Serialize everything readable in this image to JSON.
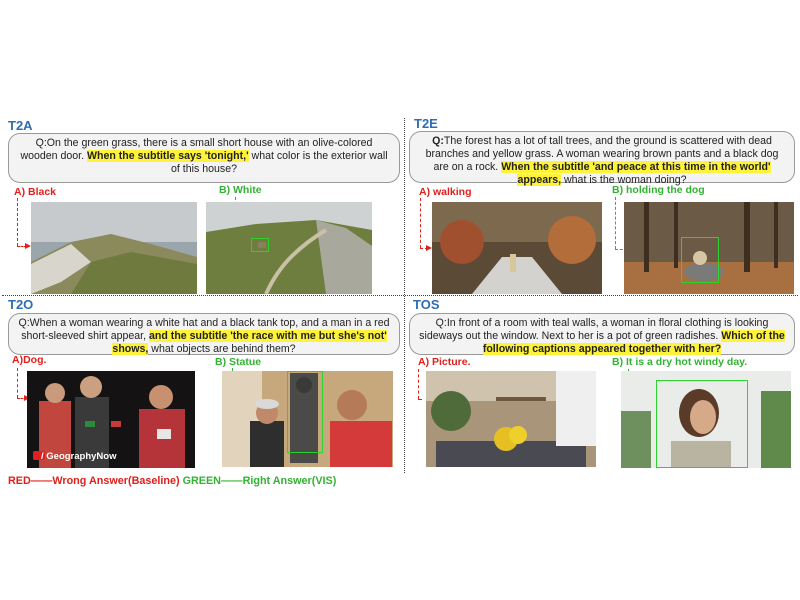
{
  "panels": {
    "t2a": {
      "tag": "T2A",
      "q_pre": "Q:On the green grass, there is a small short house with an olive-colored wooden door. ",
      "q_hl": "When the subtitle says 'tonight,'",
      "q_post": " what color is the exterior wall of this house?",
      "option_a": "A) Black",
      "option_b": "B) White"
    },
    "t2e": {
      "tag": "T2E",
      "q_prefix": "Q:",
      "q_pre": "The forest has a lot of tall trees, and the ground is scattered with dead branches and yellow grass. A woman wearing brown pants and a black dog are on a rock. ",
      "q_hl": "When the subtitle 'and peace at this time in the world' appears,",
      "q_post": " what is the woman doing?",
      "option_a": "A) walking",
      "option_b": "B) holding the dog"
    },
    "t2o": {
      "tag": "T2O",
      "q_pre": "Q:When a woman wearing a white hat and a black tank top, and a man in a red short-sleeved shirt appear, ",
      "q_hl": "and the subtitle 'the race with me but she's not' shows,",
      "q_post": " what objects are behind them?",
      "option_a": "A)Dog.",
      "option_b": "B) Statue",
      "watermark": "/ GeographyNow"
    },
    "tos": {
      "tag": "TOS",
      "q_pre": "Q:In front of a room with teal walls, a woman in floral clothing is looking sideways out the window. Next to her is a pot of green radishes. ",
      "q_hl": "Which of the following captions appeared together with her?",
      "q_post": "",
      "option_a": "A) Picture.",
      "option_b": "B) It is a dry hot windy day."
    }
  },
  "legend": {
    "red": "RED——Wrong Answer(Baseline)",
    "green": "GREEN——Right Answer(VIS)"
  },
  "colors": {
    "wrong": "#e0201b",
    "right": "#33b233",
    "tag": "#2f6db3",
    "highlight": "#fff23a"
  }
}
